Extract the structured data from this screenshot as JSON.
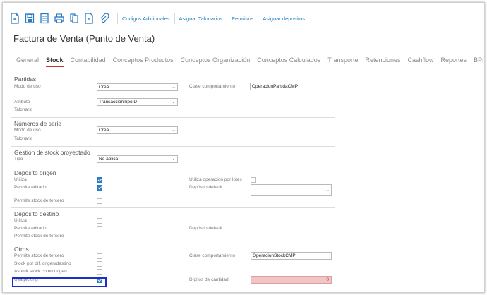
{
  "toolbar": {
    "icons": [
      "new-document-icon",
      "save-icon",
      "list-icon",
      "print-icon",
      "copy-icon",
      "pdf-icon",
      "attach-icon"
    ],
    "links": [
      "Codigos Adicionales",
      "Asignar Talonarios",
      "Permisos",
      "Asignar depositos"
    ]
  },
  "page": {
    "title": "Factura de Venta (Punto de Venta)"
  },
  "tabs": [
    "General",
    "Stock",
    "Contabilidad",
    "Conceptos Productos",
    "Conceptos Organización",
    "Conceptos Calculados",
    "Transporte",
    "Retenciones",
    "Cashflow",
    "Reportes",
    "BProc."
  ],
  "active_tab": "Stock",
  "partidas": {
    "title": "Partidas",
    "modo_uso_label": "Modo de uso",
    "modo_uso_value": "Crea",
    "clase_label": "Clase comportamiento",
    "clase_value": "OperacionPartidaCMP",
    "atributo_label": "Atributo",
    "atributo_value": "TransaccionTipoID",
    "talonario_label": "Talonario"
  },
  "numeros": {
    "title": "Números de serie",
    "modo_uso_label": "Modo de uso",
    "modo_uso_value": "Crea",
    "talonario_label": "Talonario"
  },
  "gestion": {
    "title": "Gestión de stock proyectado",
    "tipo_label": "Tipo",
    "tipo_value": "No aplica"
  },
  "origen": {
    "title": "Depósito origen",
    "utiliza_label": "Utiliza",
    "utiliza_checked": true,
    "permite_editarlo_label": "Permite editarlo",
    "permite_editarlo_checked": true,
    "permite_tercero_label": "Permite stock de tercero",
    "permite_tercero_checked": false,
    "utiliza_lotes_label": "Utiliza operacion por lotes",
    "utiliza_lotes_checked": false,
    "deposito_default_label": "Depósito default",
    "deposito_default_value": ""
  },
  "destino": {
    "title": "Depósito destino",
    "utiliza_label": "Utiliza",
    "utiliza_checked": false,
    "permite_editarlo_label": "Permite editarlo",
    "permite_editarlo_checked": false,
    "permite_tercero_label": "Permite stock de tercero",
    "permite_tercero_checked": false,
    "deposito_default_label": "Depósito default"
  },
  "otros": {
    "title": "Otros",
    "permite_tercero_label": "Permite stock de tercero",
    "permite_tercero_checked": false,
    "stock_dif_label": "Stock por dif. origen/destino",
    "stock_dif_checked": false,
    "asumir_label": "Asumir stock como origen",
    "asumir_checked": false,
    "usa_picking_label": "Usa picking",
    "usa_picking_checked": true,
    "clase_label": "Clase comportamiento",
    "clase_value": "OperacionStockCMP",
    "digitos_label": "Dígitos de cantidad",
    "digitos_value": "0"
  },
  "colors": {
    "accent": "#2b7bc1",
    "link": "#1f7fbf",
    "active_tab_underline": "#c0392b",
    "highlight_box": "#1a2ecc",
    "error_field": "#f1c5c5"
  }
}
